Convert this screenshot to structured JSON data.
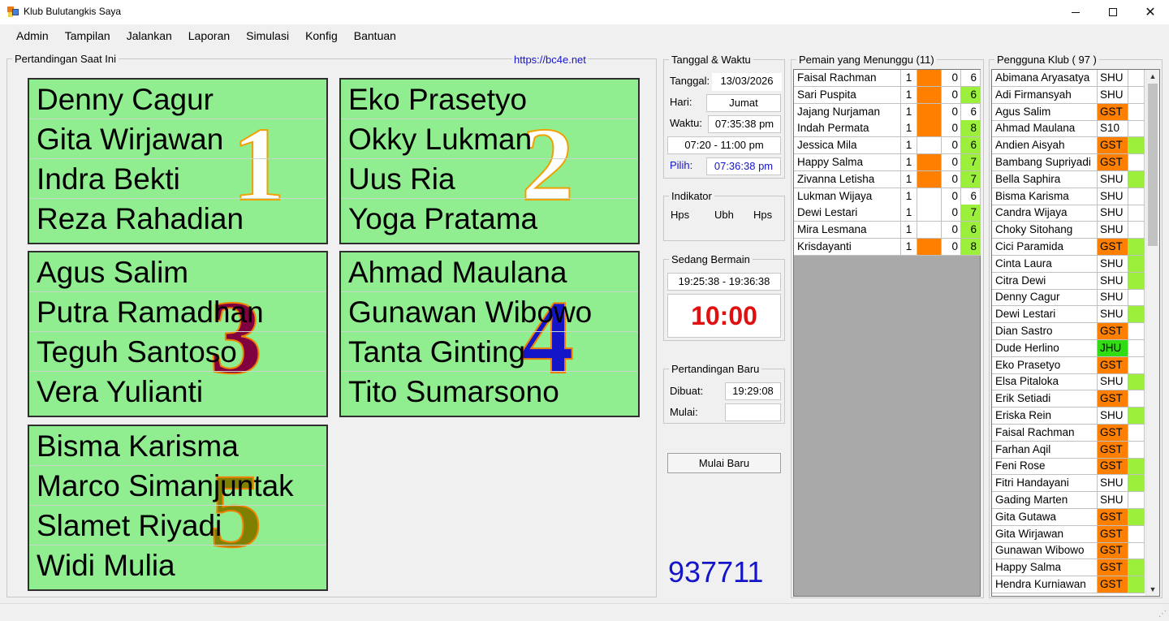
{
  "window": {
    "title": "Klub Bulutangkis Saya"
  },
  "menu": [
    "Admin",
    "Tampilan",
    "Jalankan",
    "Laporan",
    "Simulasi",
    "Konfig",
    "Bantuan"
  ],
  "current_match": {
    "legend": "Pertandingan Saat Ini",
    "link": "https://bc4e.net",
    "courts": [
      {
        "number": "1",
        "players": [
          "Denny Cagur",
          "Gita Wirjawan",
          "Indra Bekti",
          "Reza Rahadian"
        ]
      },
      {
        "number": "2",
        "players": [
          "Eko Prasetyo",
          "Okky Lukman",
          "Uus Ria",
          "Yoga Pratama"
        ]
      },
      {
        "number": "3",
        "players": [
          "Agus Salim",
          "Putra Ramadhan",
          "Teguh Santoso",
          "Vera Yulianti"
        ]
      },
      {
        "number": "4",
        "players": [
          "Ahmad Maulana",
          "Gunawan Wibowo",
          "Tanta Ginting",
          "Tito Sumarsono"
        ]
      },
      {
        "number": "5",
        "players": [
          "Bisma Karisma",
          "Marco Simanjuntak",
          "Slamet Riyadi",
          "Widi Mulia"
        ]
      }
    ]
  },
  "datetime": {
    "legend": "Tanggal & Waktu",
    "date_label": "Tanggal:",
    "date_value": "13/03/2026",
    "day_label": "Hari:",
    "day_value": "Jumat",
    "time_label": "Waktu:",
    "time_value": "07:35:38 pm",
    "range_value": "07:20 - 11:00 pm",
    "pick_label": "Pilih:",
    "pick_value": "07:36:38 pm"
  },
  "indicator": {
    "legend": "Indikator",
    "items": [
      "Hps",
      "Ubh",
      "Hps"
    ]
  },
  "playing": {
    "legend": "Sedang Bermain",
    "range": "19:25:38 - 19:36:38",
    "countdown": "10:00"
  },
  "new_match": {
    "legend": "Pertandingan Baru",
    "created_label": "Dibuat:",
    "created_value": "19:29:08",
    "start_label": "Mulai:",
    "start_value": "",
    "button": "Mulai Baru"
  },
  "code_number": "937711",
  "waiting": {
    "legend": "Pemain yang Menunggu (11)",
    "rows": [
      {
        "name": "Faisal Rachman",
        "a": "1",
        "flag": "orange",
        "c": "0",
        "d": "6",
        "d_color": "white"
      },
      {
        "name": "Sari Puspita",
        "a": "1",
        "flag": "orange",
        "c": "0",
        "d": "6",
        "d_color": "green"
      },
      {
        "name": "Jajang Nurjaman",
        "a": "1",
        "flag": "orange",
        "c": "0",
        "d": "6",
        "d_color": "white"
      },
      {
        "name": "Indah Permata",
        "a": "1",
        "flag": "orange",
        "c": "0",
        "d": "8",
        "d_color": "green"
      },
      {
        "name": "Jessica Mila",
        "a": "1",
        "flag": "white",
        "c": "0",
        "d": "6",
        "d_color": "green"
      },
      {
        "name": "Happy Salma",
        "a": "1",
        "flag": "orange",
        "c": "0",
        "d": "7",
        "d_color": "green"
      },
      {
        "name": "Zivanna Letisha",
        "a": "1",
        "flag": "orange",
        "c": "0",
        "d": "7",
        "d_color": "green"
      },
      {
        "name": "Lukman Wijaya",
        "a": "1",
        "flag": "white",
        "c": "0",
        "d": "6",
        "d_color": "white"
      },
      {
        "name": "Dewi Lestari",
        "a": "1",
        "flag": "white",
        "c": "0",
        "d": "7",
        "d_color": "green"
      },
      {
        "name": "Mira Lesmana",
        "a": "1",
        "flag": "white",
        "c": "0",
        "d": "6",
        "d_color": "green"
      },
      {
        "name": "Krisdayanti",
        "a": "1",
        "flag": "orange",
        "c": "0",
        "d": "8",
        "d_color": "green"
      }
    ]
  },
  "club": {
    "legend": "Pengguna Klub ( 97 )",
    "rows": [
      {
        "name": "Abimana Aryasatya",
        "status": "SHU",
        "st_color": "white",
        "mark": "white"
      },
      {
        "name": "Adi Firmansyah",
        "status": "SHU",
        "st_color": "white",
        "mark": "white"
      },
      {
        "name": "Agus Salim",
        "status": "GST",
        "st_color": "orange",
        "mark": "white"
      },
      {
        "name": "Ahmad Maulana",
        "status": "S10",
        "st_color": "white",
        "mark": "white"
      },
      {
        "name": "Andien Aisyah",
        "status": "GST",
        "st_color": "orange",
        "mark": "green"
      },
      {
        "name": "Bambang Supriyadi",
        "status": "GST",
        "st_color": "orange",
        "mark": "white"
      },
      {
        "name": "Bella Saphira",
        "status": "SHU",
        "st_color": "white",
        "mark": "green"
      },
      {
        "name": "Bisma Karisma",
        "status": "SHU",
        "st_color": "white",
        "mark": "white"
      },
      {
        "name": "Candra Wijaya",
        "status": "SHU",
        "st_color": "white",
        "mark": "white"
      },
      {
        "name": "Choky Sitohang",
        "status": "SHU",
        "st_color": "white",
        "mark": "white"
      },
      {
        "name": "Cici Paramida",
        "status": "GST",
        "st_color": "orange",
        "mark": "green"
      },
      {
        "name": "Cinta Laura",
        "status": "SHU",
        "st_color": "white",
        "mark": "green"
      },
      {
        "name": "Citra Dewi",
        "status": "SHU",
        "st_color": "white",
        "mark": "green"
      },
      {
        "name": "Denny Cagur",
        "status": "SHU",
        "st_color": "white",
        "mark": "white"
      },
      {
        "name": "Dewi Lestari",
        "status": "SHU",
        "st_color": "white",
        "mark": "green"
      },
      {
        "name": "Dian Sastro",
        "status": "GST",
        "st_color": "orange",
        "mark": "white"
      },
      {
        "name": "Dude Herlino",
        "status": "JHU",
        "st_color": "bright-green",
        "mark": "white"
      },
      {
        "name": "Eko Prasetyo",
        "status": "GST",
        "st_color": "orange",
        "mark": "white"
      },
      {
        "name": "Elsa Pitaloka",
        "status": "SHU",
        "st_color": "white",
        "mark": "green"
      },
      {
        "name": "Erik Setiadi",
        "status": "GST",
        "st_color": "orange",
        "mark": "white"
      },
      {
        "name": "Eriska Rein",
        "status": "SHU",
        "st_color": "white",
        "mark": "green"
      },
      {
        "name": "Faisal Rachman",
        "status": "GST",
        "st_color": "orange",
        "mark": "white"
      },
      {
        "name": "Farhan Aqil",
        "status": "GST",
        "st_color": "orange",
        "mark": "white"
      },
      {
        "name": "Feni Rose",
        "status": "GST",
        "st_color": "orange",
        "mark": "green"
      },
      {
        "name": "Fitri Handayani",
        "status": "SHU",
        "st_color": "white",
        "mark": "green"
      },
      {
        "name": "Gading Marten",
        "status": "SHU",
        "st_color": "white",
        "mark": "white"
      },
      {
        "name": "Gita Gutawa",
        "status": "GST",
        "st_color": "orange",
        "mark": "green"
      },
      {
        "name": "Gita Wirjawan",
        "status": "GST",
        "st_color": "orange",
        "mark": "white"
      },
      {
        "name": "Gunawan Wibowo",
        "status": "GST",
        "st_color": "orange",
        "mark": "white"
      },
      {
        "name": "Happy Salma",
        "status": "GST",
        "st_color": "orange",
        "mark": "green"
      },
      {
        "name": "Hendra Kurniawan",
        "status": "GST",
        "st_color": "orange",
        "mark": "green"
      }
    ]
  },
  "colors": {
    "court_bg": "#90ee90",
    "orange": "#ff8000",
    "green": "#9cf03c",
    "bright_green": "#32dc14",
    "countdown": "#e01010",
    "code_number": "#1414c8",
    "link": "#1414c8",
    "court1_num": "#ffffff",
    "court2_num": "#ffffff",
    "court3_num": "#800040",
    "court4_num": "#1414c8",
    "court5_num": "#808000"
  }
}
